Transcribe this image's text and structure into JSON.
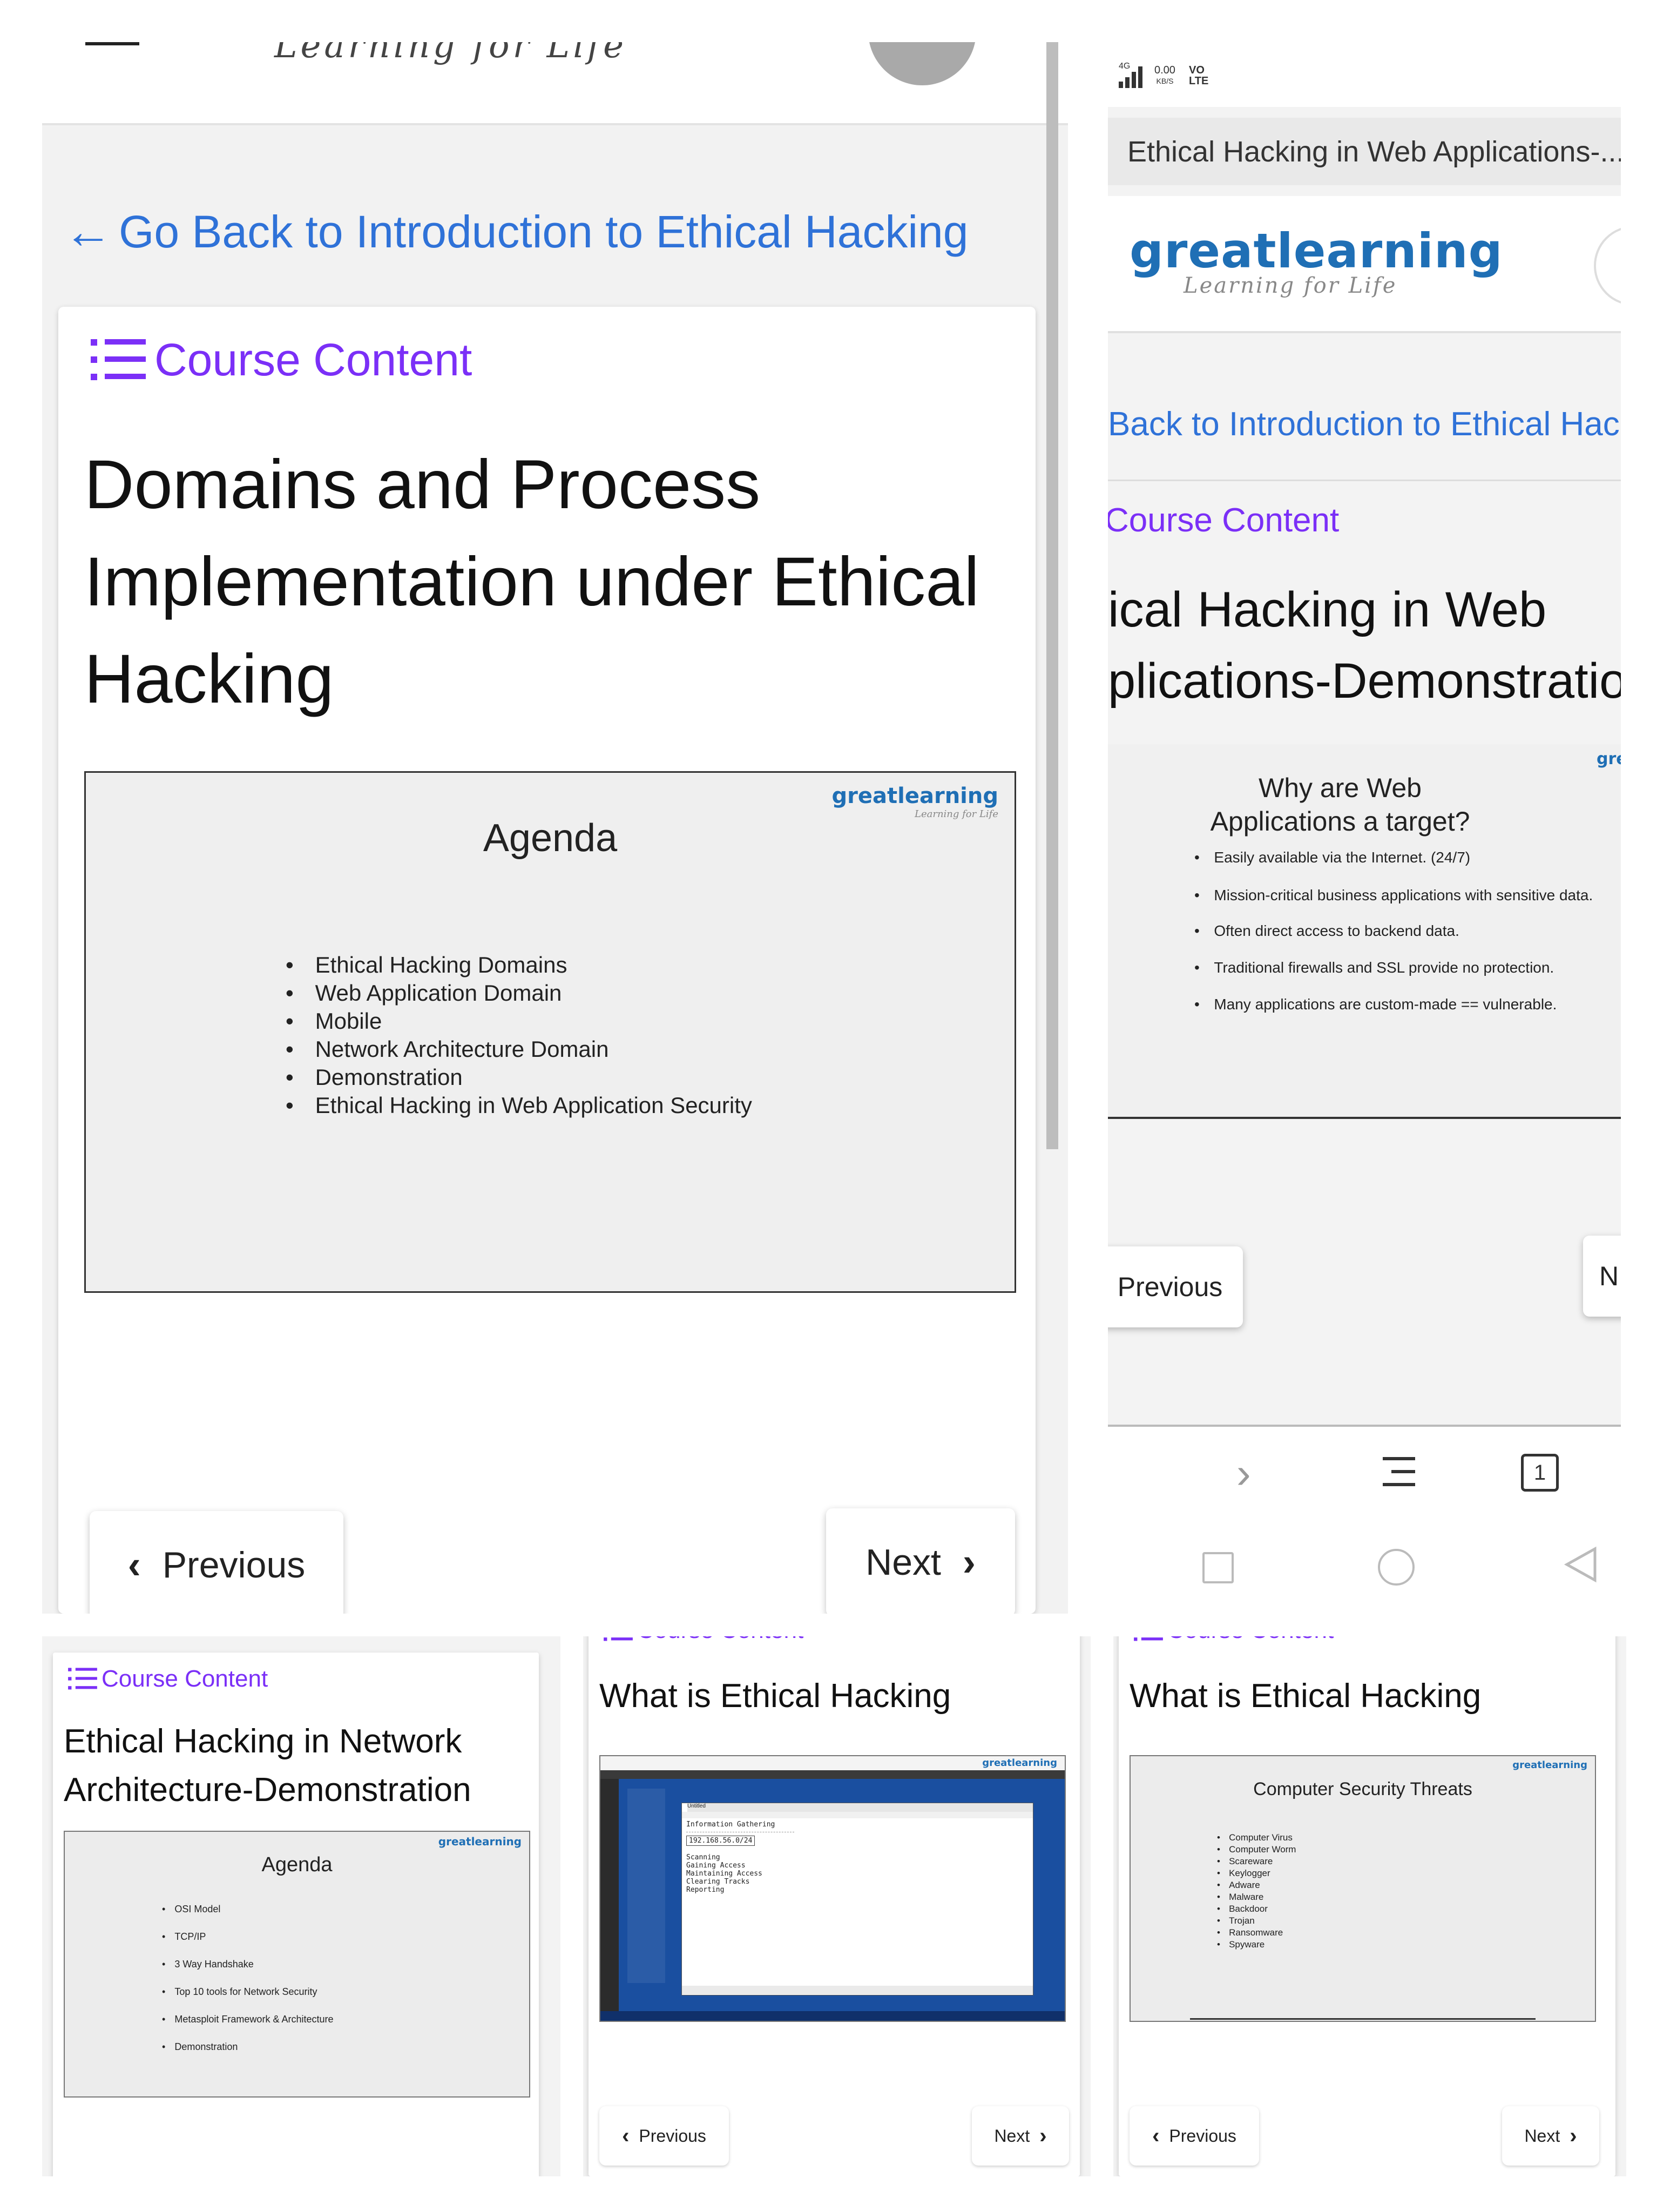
{
  "panel1": {
    "brand_tagline": "Learning for Life",
    "back_link": "Go Back to Introduction to Ethical Hacking",
    "course_content": "Course Content",
    "title": "Domains and Process Implementation under Ethical Hacking",
    "slide": {
      "logo_name": "greatlearning",
      "logo_tagline": "Learning for Life",
      "heading": "Agenda",
      "bullets": [
        "Ethical Hacking Domains",
        "Web Application Domain",
        "Mobile",
        "Network Architecture Domain",
        "Demonstration",
        "Ethical Hacking in Web Application Security"
      ]
    },
    "prev_label": "Previous",
    "next_label": "Next"
  },
  "panel2": {
    "status": {
      "net": "4G",
      "speed": "0.00",
      "speed_unit": "KB/S",
      "vo": "VO",
      "lte": "LTE"
    },
    "tab_title": "Ethical Hacking in Web Applications-...",
    "logo_name": "greatlearning",
    "logo_tagline": "Learning for Life",
    "back_link": "Back to Introduction to Ethical Hac",
    "course_content": "Course Content",
    "title": "ical Hacking in Web plications-Demonstratio",
    "slide": {
      "logo_fragment": "gre",
      "heading": "Why are Web Applications a target?",
      "bullets": [
        "Easily available via the Internet. (24/7)",
        "Mission-critical business applications with sensitive data.",
        "Often direct access to backend data.",
        "Traditional firewalls and SSL provide no protection.",
        "Many applications are custom-made == vulnerable."
      ]
    },
    "prev_label": "Previous",
    "next_fragment": "N",
    "nav": {
      "tab_count": "1"
    }
  },
  "panel3": {
    "course_content": "Course Content",
    "title": "Ethical Hacking in Network Architecture-Demonstration",
    "slide": {
      "logo_name": "greatlearning",
      "heading": "Agenda",
      "bullets": [
        "OSI Model",
        "TCP/IP",
        "3 Way Handshake",
        "Top 10 tools for Network Security",
        "Metasploit Framework & Architecture",
        "Demonstration"
      ]
    }
  },
  "panel4": {
    "course_content": "Course Content",
    "title": "What is Ethical Hacking",
    "slide": {
      "logo_name": "greatlearning",
      "window_title": "Untitled",
      "editor_lines": [
        "Information Gathering",
        "192.168.56.0/24",
        "Scanning",
        "Gaining Access",
        "Maintaining Access",
        "Clearing Tracks",
        "Reporting"
      ]
    },
    "prev_label": "Previous",
    "next_label": "Next"
  },
  "panel5": {
    "course_content": "Course Content",
    "title": "What is Ethical Hacking",
    "slide": {
      "logo_name": "greatlearning",
      "heading": "Computer Security Threats",
      "bullets": [
        "Computer Virus",
        "Computer Worm",
        "Scareware",
        "Keylogger",
        "Adware",
        "Malware",
        "Backdoor",
        "Trojan",
        "Ransomware",
        "Spyware"
      ]
    },
    "prev_label": "Previous",
    "next_label": "Next"
  },
  "colors": {
    "link_blue": "#2f72d8",
    "course_purple": "#7b2ff7",
    "brand_blue": "#1f6fb5",
    "desktop_blue": "#1a4fa0"
  }
}
